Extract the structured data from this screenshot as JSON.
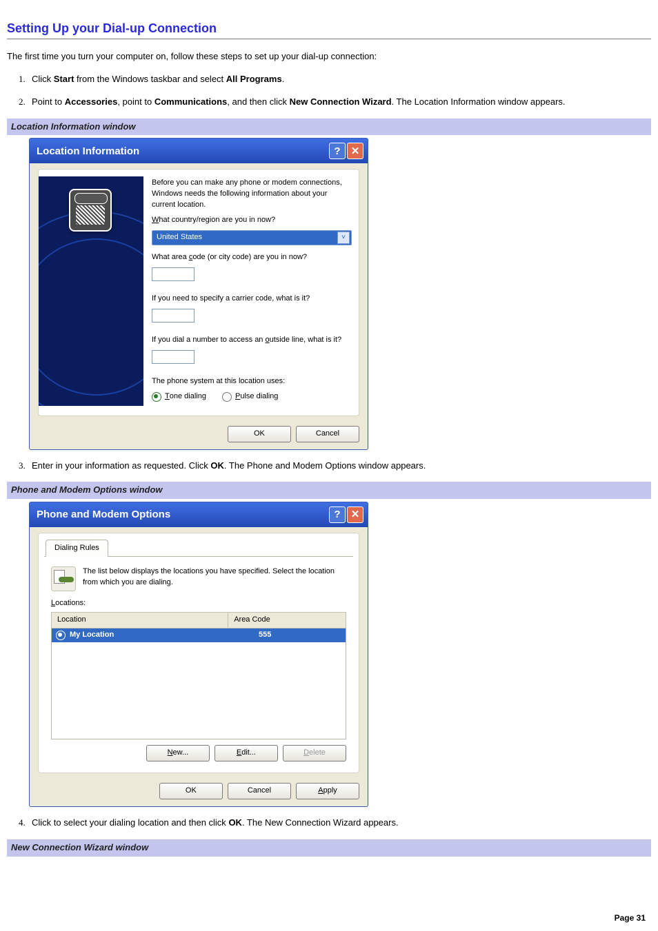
{
  "title": "Setting Up your Dial-up Connection",
  "intro": "The first time you turn your computer on, follow these steps to set up your dial-up connection:",
  "steps": {
    "s1a": "Click ",
    "s1b": "Start",
    "s1c": " from the Windows taskbar and select ",
    "s1d": "All Programs",
    "s1e": ".",
    "s2a": "Point to ",
    "s2b": "Accessories",
    "s2c": ", point to ",
    "s2d": "Communications",
    "s2e": ", and then click ",
    "s2f": "New Connection Wizard",
    "s2g": ". The Location Information window appears.",
    "s3a": "Enter in your information as requested. Click ",
    "s3b": "OK",
    "s3c": ". The Phone and Modem Options window appears.",
    "s4a": "Click to select your dialing location and then click ",
    "s4b": "OK",
    "s4c": ". The New Connection Wizard appears."
  },
  "caption1": "Location Information window",
  "caption2": "Phone and Modem Options window",
  "caption3": "New Connection Wizard window",
  "loc": {
    "title": "Location Information",
    "intro": "Before you can make any phone or modem connections, Windows needs the following information about your current location.",
    "q1a": "W",
    "q1b": "hat country/region are you in now?",
    "sel": "United States",
    "q2a": "What area ",
    "q2b": "c",
    "q2c": "ode (or city code) are you in now?",
    "q3": "If you need to specify a carrier code, what is it?",
    "q4a": "If you dial a number to access an ",
    "q4b": "o",
    "q4c": "utside line, what is it?",
    "q5": "The phone system at this location uses:",
    "r1a": "T",
    "r1b": "one dialing",
    "r2a": "P",
    "r2b": "ulse dialing",
    "ok": "OK",
    "cancel": "Cancel"
  },
  "pm": {
    "title": "Phone and Modem Options",
    "tab": "Dialing Rules",
    "desc": "The list below displays the locations you have specified. Select the location from which you are dialing.",
    "locs_u": "L",
    "locs": "ocations:",
    "col1": "Location",
    "col2": "Area Code",
    "row_loc": "My Location",
    "row_ac": "555",
    "new_u": "N",
    "new": "ew...",
    "edit_u": "E",
    "edit": "dit...",
    "del_u": "D",
    "del": "elete",
    "ok": "OK",
    "cancel": "Cancel",
    "apply_u": "A",
    "apply": "pply"
  },
  "pagenum": "Page 31"
}
